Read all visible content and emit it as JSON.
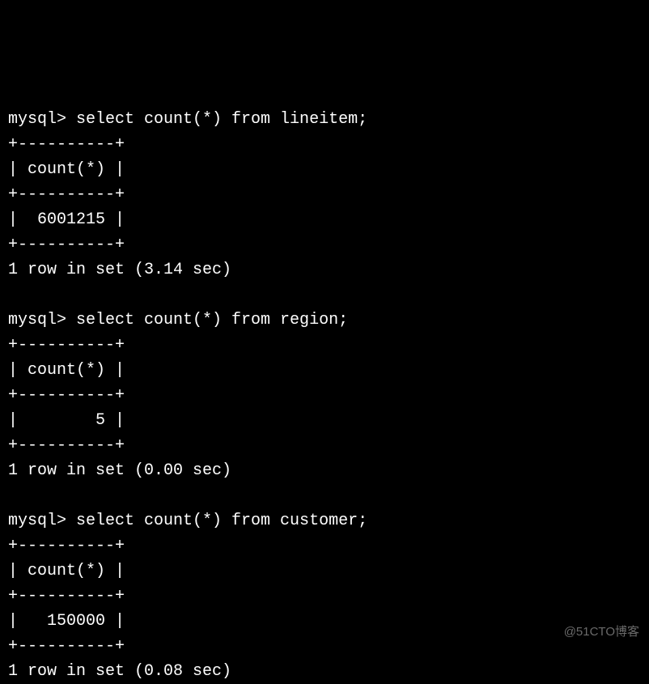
{
  "queries": [
    {
      "prompt": "mysql> ",
      "sql": "select count(*) from lineitem;",
      "border": "+----------+",
      "header": "| count(*) |",
      "value_row": "|  6001215 |",
      "summary": "1 row in set (3.14 sec)"
    },
    {
      "prompt": "mysql> ",
      "sql": "select count(*) from region;",
      "border": "+----------+",
      "header": "| count(*) |",
      "value_row": "|        5 |",
      "summary": "1 row in set (0.00 sec)"
    },
    {
      "prompt": "mysql> ",
      "sql": "select count(*) from customer;",
      "border": "+----------+",
      "header": "| count(*) |",
      "value_row": "|   150000 |",
      "summary": "1 row in set (0.08 sec)"
    }
  ],
  "watermark": "@51CTO博客"
}
